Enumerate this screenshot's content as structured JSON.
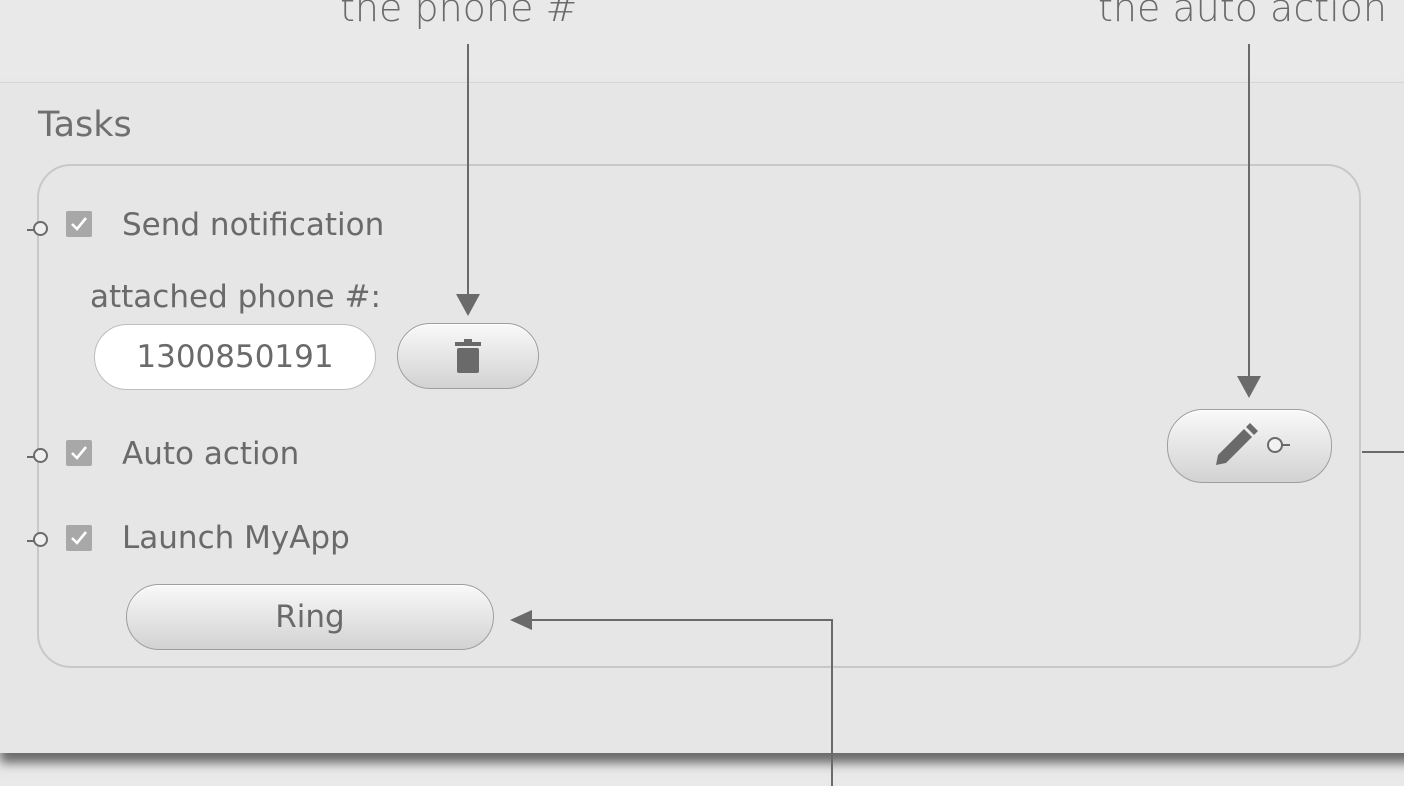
{
  "annotations": {
    "phone_note": "the phone #",
    "auto_action_note": "the auto action"
  },
  "panel": {
    "title": "Tasks"
  },
  "tasks": [
    {
      "label": "Send notification",
      "checked": true
    },
    {
      "label": "Auto action",
      "checked": true
    },
    {
      "label": "Launch MyApp",
      "checked": true
    }
  ],
  "phone": {
    "label": "attached phone #:",
    "value": "1300850191"
  },
  "buttons": {
    "ring_label": "Ring"
  },
  "icons": {
    "delete": "trash-icon",
    "edit": "pencil-icon",
    "check": "checkmark-icon"
  },
  "colors": {
    "background": "#e9e9e9",
    "text": "#6a6a6a",
    "checkbox": "#a8a8a8",
    "arrow": "#6a6a6a"
  }
}
